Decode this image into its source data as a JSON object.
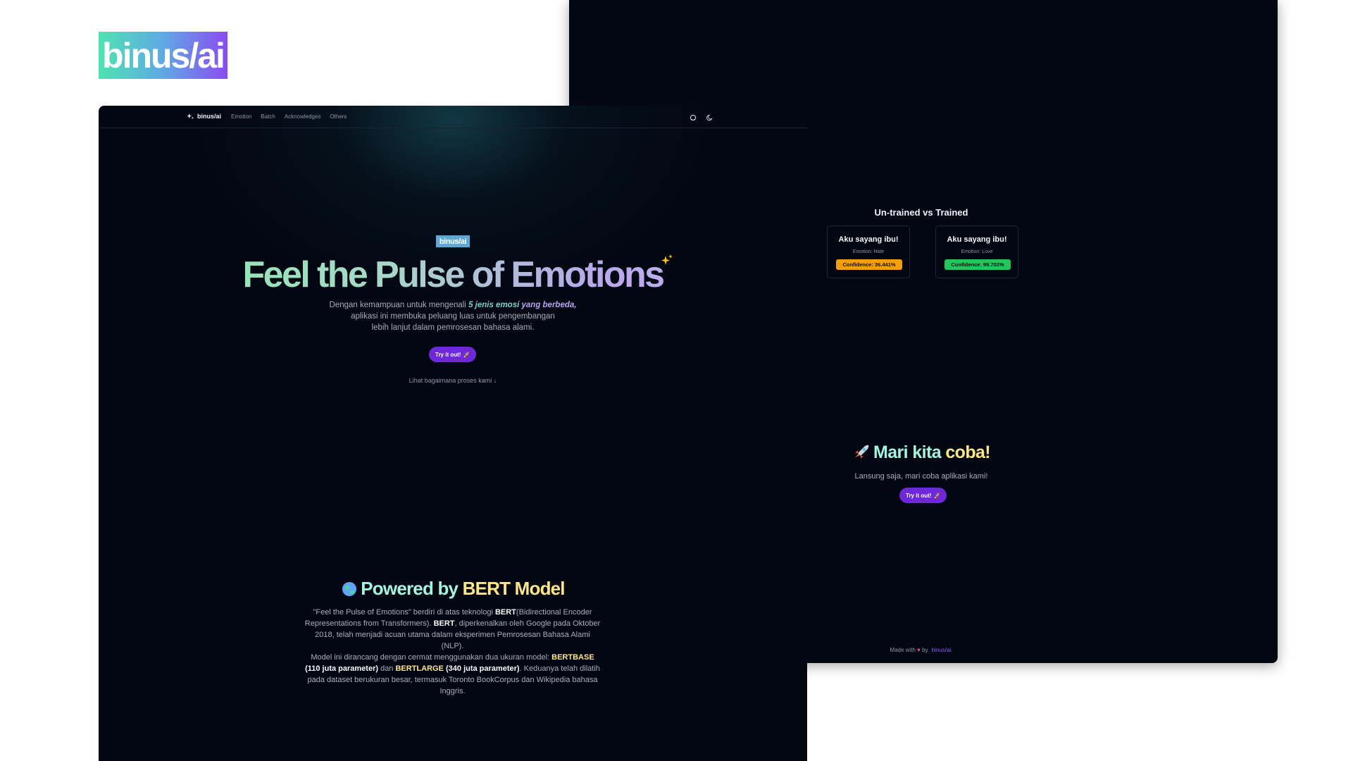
{
  "logo": {
    "text": "binus/ai"
  },
  "nav": {
    "brand": "binus/ai",
    "links": [
      "Emotion",
      "Batch",
      "Acknowledges",
      "Others"
    ],
    "icons": [
      "github-icon",
      "moon-icon"
    ]
  },
  "hero": {
    "badge": "binus/ai",
    "title": "Feel the Pulse of Emotions",
    "sub_line1_pre": "Dengan kemampuan untuk mengenali ",
    "sub_highlight_a": "5 jenis emosi ",
    "sub_highlight_b": "yang berbeda,",
    "sub_line2": "aplikasi ini membuka peluang luas untuk pengembangan",
    "sub_line3": "lebih lanjut dalam pemrosesan bahasa alami.",
    "button_label": "Try it out!",
    "scroll_hint": "Lihat bagaimana proses kami ↓"
  },
  "bert": {
    "title_a": "Powered by ",
    "title_b": "BERT Model",
    "p1_a": "\"Feel the Pulse of Emotions\" berdiri di atas teknologi ",
    "p1_b": "BERT",
    "p1_c": "(Bidirectional Encoder Representations from Transformers). ",
    "p1_d": "BERT",
    "p1_e": ", diperkenalkan oleh Google pada Oktober 2018, telah menjadi acuan utama dalam eksperimen Pemrosesan Bahasa Alami (NLP).",
    "p2_a": "Model ini dirancang dengan cermat menggunakan dua ukuran model: ",
    "p2_b": "BERTBASE",
    "p2_c": "(110 juta parameter)",
    "p2_d": " dan ",
    "p2_e": "BERTLARGE",
    "p2_f": "(340 juta parameter)",
    "p2_g": ". Keduanya telah dilatih pada dataset berukuran besar, termasuk Toronto BookCorpus dan Wikipedia bahasa Inggris."
  },
  "comparison": {
    "title": "Un-trained vs Trained",
    "cards": [
      {
        "text": "Aku sayang ibu!",
        "emotion": "Emotion: Hate",
        "confidence": "Confidence: 36.441%"
      },
      {
        "text": "Aku sayang ibu!",
        "emotion": "Emotion: Love",
        "confidence": "Confidence: 99.702%"
      }
    ]
  },
  "try": {
    "title_a": "Mari kita ",
    "title_b": "coba!",
    "subtitle": "Lansung saja, mari coba aplikasi kami!",
    "button_label": "Try it out!"
  },
  "footer": {
    "pre": "Made with",
    "by": "by",
    "brand": "binus/ai."
  },
  "colors": {
    "background": "#030711",
    "accent": "#6d28d9",
    "confidence_low": "#f59e0b",
    "confidence_high": "#22c55e"
  }
}
